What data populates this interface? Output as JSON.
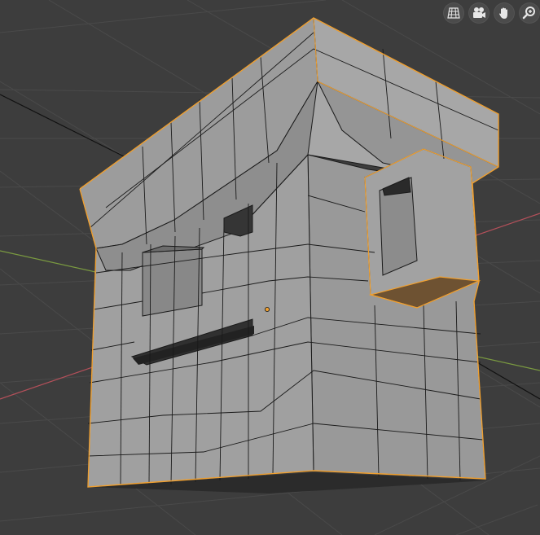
{
  "viewport": {
    "background": "#3d3d3d",
    "grid_color": "#4a4a4a",
    "x_axis_color": "#b4505a",
    "y_axis_color": "#7a9a40",
    "selection_color": "#f0a030",
    "mesh_face_color": "#9d9d9d",
    "mesh_edge_color": "#1a1a1a",
    "selected_face_color": "#6e5232"
  },
  "nav_gizmo": {
    "buttons": [
      {
        "name": "toggle-perspective",
        "icon": "grid-perspective-icon"
      },
      {
        "name": "camera-view",
        "icon": "camera-icon"
      },
      {
        "name": "pan-view",
        "icon": "hand-icon"
      },
      {
        "name": "zoom-view",
        "icon": "magnifier-icon"
      }
    ]
  }
}
